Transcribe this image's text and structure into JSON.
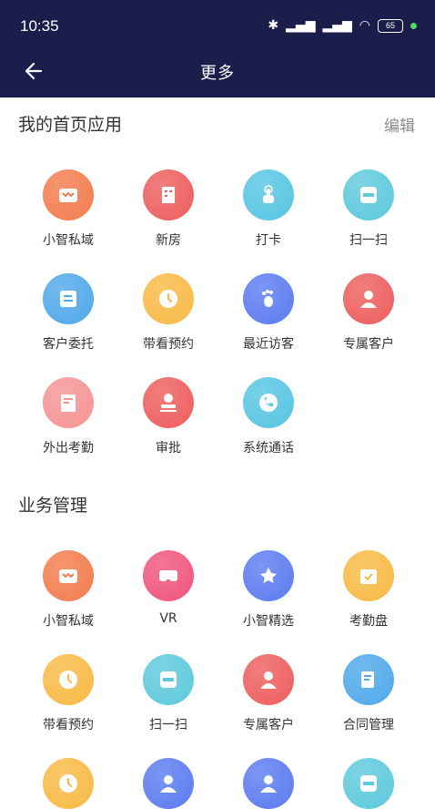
{
  "status": {
    "time": "10:35",
    "battery": "65"
  },
  "header": {
    "title": "更多"
  },
  "my_apps": {
    "title": "我的首页应用",
    "edit_label": "编辑",
    "items": [
      {
        "label": "小智私域",
        "icon": "store-icon",
        "color": "#f37b4d"
      },
      {
        "label": "新房",
        "icon": "building-icon",
        "color": "#ee5d5d"
      },
      {
        "label": "打卡",
        "icon": "tap-hand-icon",
        "color": "#56c5e2"
      },
      {
        "label": "扫一扫",
        "icon": "scan-icon",
        "color": "#5cc9dc"
      },
      {
        "label": "客户委托",
        "icon": "entrust-icon",
        "color": "#4fa8ea"
      },
      {
        "label": "带看预约",
        "icon": "clock-icon",
        "color": "#f8b944"
      },
      {
        "label": "最近访客",
        "icon": "footprint-icon",
        "color": "#5b7bf0"
      },
      {
        "label": "专属客户",
        "icon": "person-icon",
        "color": "#ee5d5d"
      },
      {
        "label": "外出考勤",
        "icon": "attendance-icon",
        "color": "#f59393"
      },
      {
        "label": "审批",
        "icon": "stamp-icon",
        "color": "#ee5d5d"
      },
      {
        "label": "系统通话",
        "icon": "phone-icon",
        "color": "#56c5e2"
      }
    ]
  },
  "business": {
    "title": "业务管理",
    "items": [
      {
        "label": "小智私域",
        "icon": "store-icon",
        "color": "#f37b4d"
      },
      {
        "label": "VR",
        "icon": "vr-goggles-icon",
        "color": "#f0547b"
      },
      {
        "label": "小智精选",
        "icon": "star-badge-icon",
        "color": "#5b7bf0"
      },
      {
        "label": "考勤盘",
        "icon": "calendar-check-icon",
        "color": "#f8b944"
      },
      {
        "label": "带看预约",
        "icon": "clock-icon",
        "color": "#f8b944"
      },
      {
        "label": "扫一扫",
        "icon": "scan-icon",
        "color": "#5cc9dc"
      },
      {
        "label": "专属客户",
        "icon": "person-icon",
        "color": "#ee5d5d"
      },
      {
        "label": "合同管理",
        "icon": "contract-icon",
        "color": "#4fa8ea"
      }
    ]
  },
  "partial_row": [
    {
      "icon": "clock-icon",
      "color": "#f8b944"
    },
    {
      "icon": "user-icon",
      "color": "#5b7bf0"
    },
    {
      "icon": "user-icon",
      "color": "#5b7bf0"
    },
    {
      "icon": "scan-icon",
      "color": "#5cc9dc"
    }
  ]
}
